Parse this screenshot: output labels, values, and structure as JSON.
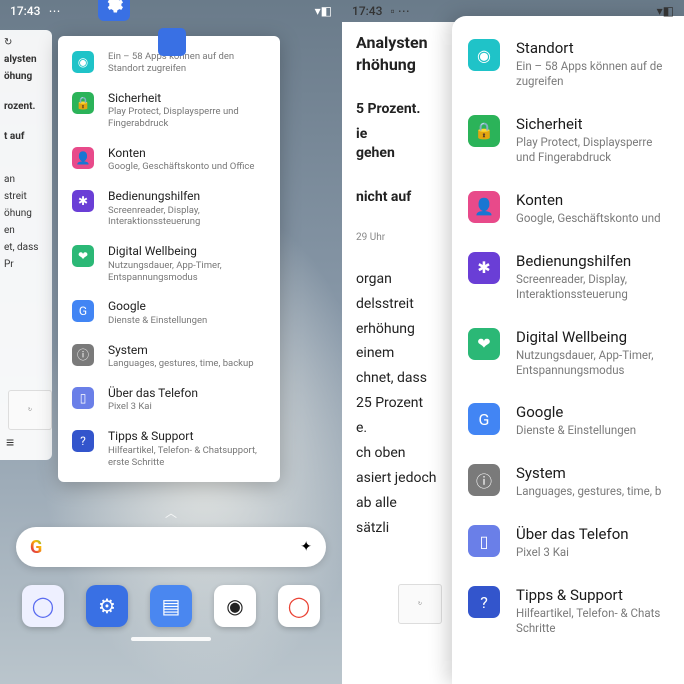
{
  "status": {
    "time": "17:43",
    "wifi": "▾",
    "batt": "▮"
  },
  "icons": {
    "location": {
      "bg": "#1fc3c8",
      "g": "◉"
    },
    "security": {
      "bg": "#2bb359",
      "g": "🔒"
    },
    "accounts": {
      "bg": "#e84a8a",
      "g": "👤"
    },
    "a11y": {
      "bg": "#6a3ed6",
      "g": "✱"
    },
    "wellbeing": {
      "bg": "#2bb876",
      "g": "❤"
    },
    "google": {
      "bg": "#4285f4",
      "g": "G"
    },
    "system": {
      "bg": "#7a7a7a",
      "g": "ⓘ"
    },
    "about": {
      "bg": "#6a7fe8",
      "g": "▯"
    },
    "tips": {
      "bg": "#3355cc",
      "g": "?"
    }
  },
  "settings": [
    {
      "key": "location",
      "title": "Standort",
      "sub": "Ein – 58 Apps können auf den Standort zugreifen",
      "subR": "Ein – 58 Apps können auf de\nzugreifen"
    },
    {
      "key": "security",
      "title": "Sicherheit",
      "sub": "Play Protect, Displaysperre und Fingerabdruck",
      "subR": "Play Protect, Displaysperre und Fingerabdruck"
    },
    {
      "key": "accounts",
      "title": "Konten",
      "sub": "Google, Geschäftskonto und Office",
      "subR": "Google, Geschäftskonto und"
    },
    {
      "key": "a11y",
      "title": "Bedienungshilfen",
      "sub": "Screenreader, Display, Interaktionssteuerung",
      "subR": "Screenreader, Display, Interaktionssteuerung"
    },
    {
      "key": "wellbeing",
      "title": "Digital Wellbeing",
      "sub": "Nutzungsdauer, App-Timer, Entspannungsmodus",
      "subR": "Nutzungsdauer, App-Timer, Entspannungsmodus"
    },
    {
      "key": "google",
      "title": "Google",
      "sub": "Dienste & Einstellungen",
      "subR": "Dienste & Einstellungen"
    },
    {
      "key": "system",
      "title": "System",
      "sub": "Languages, gestures, time, backup",
      "subR": "Languages, gestures, time, b"
    },
    {
      "key": "about",
      "title": "Über das Telefon",
      "sub": "Pixel 3 Kai",
      "subR": "Pixel 3 Kai"
    },
    {
      "key": "tips",
      "title": "Tipps & Support",
      "sub": "Hilfeartikel, Telefon- & Chatsupport, erste Schritte",
      "subR": "Hilfeartikel, Telefon- & Chats\nSchritte"
    }
  ],
  "leftArticle": {
    "l1": "↻",
    "l2": "alysten",
    "l3": "öhung",
    "l4": "rozent.",
    "l5": "t auf",
    "l6": "an",
    "l7": "streit",
    "l8": "öhung",
    "l9": "en",
    "l10": "et, dass",
    "l11": "Pr",
    "menu": "≡"
  },
  "rightArticle": {
    "h": "Analysten\nrhöhung",
    "p1": "5 Prozent.",
    "p2": "ie\ngehen",
    "p3": "nicht auf",
    "meta": "29 Uhr",
    "b1": "organ",
    "b2": "delsstreit",
    "b3": "erhöhung",
    "b4": "einem",
    "b5": "chnet, dass",
    "b6": "25 Prozent",
    "b7": "e.",
    "b8": "ch oben",
    "b9": "asiert jedoch",
    "b10": "ab alle",
    "b11": "sätzli"
  },
  "dock": {
    "assistant": {
      "bg": "#eef0ff",
      "g": "◯",
      "c": "#5a6cf0"
    },
    "settings": {
      "bg": "#3970e4",
      "g": "⚙",
      "c": "#fff"
    },
    "docs": {
      "bg": "#4a87f0",
      "g": "▤",
      "c": "#fff"
    },
    "camera": {
      "bg": "#fff",
      "g": "◉",
      "c": "#222"
    },
    "chrome": {
      "bg": "#fff",
      "g": "◯",
      "c": "#ea4335"
    }
  }
}
